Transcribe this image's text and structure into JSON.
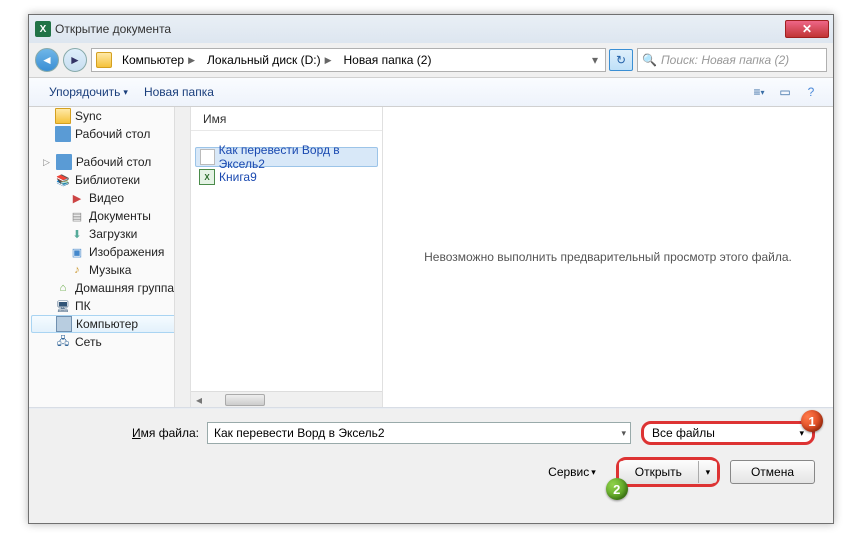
{
  "window": {
    "title": "Открытие документа"
  },
  "breadcrumb": {
    "segments": [
      "Компьютер",
      "Локальный диск (D:)",
      "Новая папка (2)"
    ]
  },
  "search": {
    "placeholder": "Поиск: Новая папка (2)"
  },
  "toolbar": {
    "organize": "Упорядочить",
    "newfolder": "Новая папка"
  },
  "sidebar": {
    "items": [
      {
        "label": "Sync",
        "icon": "folder"
      },
      {
        "label": "Рабочий стол",
        "icon": "desk"
      }
    ],
    "group2_title": "Рабочий стол",
    "group2": [
      {
        "label": "Библиотеки",
        "icon": "lib"
      },
      {
        "label": "Видео",
        "icon": "vid"
      },
      {
        "label": "Документы",
        "icon": "doc"
      },
      {
        "label": "Загрузки",
        "icon": "down"
      },
      {
        "label": "Изображения",
        "icon": "img"
      },
      {
        "label": "Музыка",
        "icon": "mus"
      },
      {
        "label": "Домашняя группа",
        "icon": "home"
      },
      {
        "label": "ПК",
        "icon": "pc"
      },
      {
        "label": "Компьютер",
        "icon": "comp",
        "selected": true
      },
      {
        "label": "Сеть",
        "icon": "net"
      }
    ]
  },
  "filelist": {
    "col_name": "Имя",
    "files": [
      {
        "label": "Как перевести Ворд в Эксель2",
        "icon": "txt",
        "selected": true
      },
      {
        "label": "Книга9",
        "icon": "xls"
      }
    ]
  },
  "preview": {
    "message": "Невозможно выполнить предварительный просмотр этого файла."
  },
  "footer": {
    "filename_label_pre": "",
    "filename_label_u": "И",
    "filename_label_post": "мя файла:",
    "filename_value": "Как перевести Ворд в Эксель2",
    "filter_value": "Все файлы",
    "service": "Сервис",
    "open": "Открыть",
    "cancel": "Отмена",
    "badge1": "1",
    "badge2": "2"
  }
}
